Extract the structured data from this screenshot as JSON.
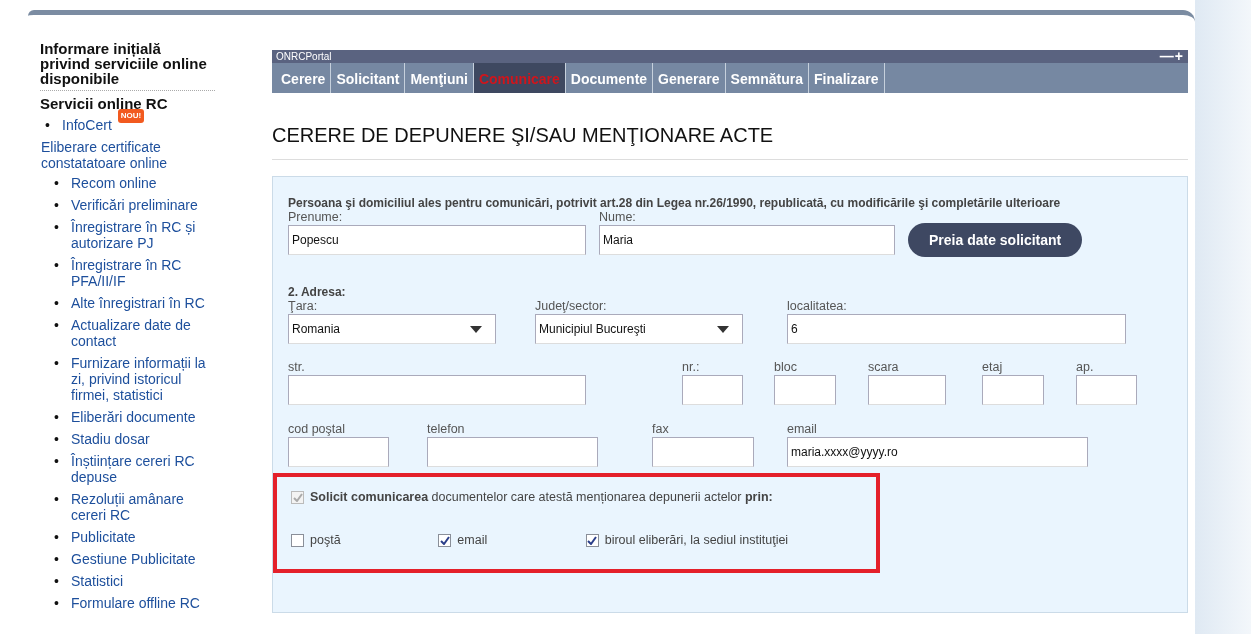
{
  "sidebar": {
    "intro_heading": "Informare inițială privind serviciile online disponibile",
    "section_heading": "Servicii online RC",
    "bullet": "•",
    "featured": {
      "label": "InfoCert",
      "badge": "NOU!"
    },
    "featured_description": "Eliberare certificate constatatoare online",
    "items": [
      "Recom online",
      "Verificări preliminare",
      "Înregistrare în RC și autorizare PJ",
      "Înregistrare în RC PFA/II/IF",
      "Alte înregistrari în RC",
      "Actualizare date de contact",
      "Furnizare informații la zi, privind istoricul firmei, statistici",
      "Eliberări documente",
      "Stadiu dosar",
      "Înștiințare cereri RC depuse",
      "Rezoluții amânare cereri RC",
      "Publicitate",
      "Gestiune Publicitate",
      "Statistici",
      "Formulare offline RC"
    ]
  },
  "portal": {
    "title": "ONRCPortal",
    "controls": "—+",
    "tabs": [
      {
        "label": "Cerere",
        "selected": false
      },
      {
        "label": "Solicitant",
        "selected": false
      },
      {
        "label": "Menţiuni",
        "selected": false
      },
      {
        "label": "Comunicare",
        "selected": true
      },
      {
        "label": "Documente",
        "selected": false
      },
      {
        "label": "Generare",
        "selected": false
      },
      {
        "label": "Semnătura",
        "selected": false
      },
      {
        "label": "Finalizare",
        "selected": false
      }
    ]
  },
  "page_title": "CERERE DE DEPUNERE ŞI/SAU MENŢIONARE ACTE",
  "form": {
    "intro": "Persoana şi domiciliul ales pentru comunicări, potrivit art.28 din Legea nr.26/1990, republicată, cu modificările şi completările ulterioare",
    "prenume": {
      "label": "Prenume:",
      "value": "Popescu"
    },
    "nume": {
      "label": "Nume:",
      "value": "Maria"
    },
    "fill_button": "Preia date solicitant",
    "address_heading": "2. Adresa:",
    "tara": {
      "label": "Ţara:",
      "value": "Romania"
    },
    "judet": {
      "label": "Judeţ/sector:",
      "value": "Municipiul Bucureşti"
    },
    "localitatea": {
      "label": "localitatea:",
      "value": "6"
    },
    "address_fields": [
      {
        "label": "str."
      },
      {
        "label": "nr.:"
      },
      {
        "label": "bloc"
      },
      {
        "label": "scara"
      },
      {
        "label": "etaj"
      },
      {
        "label": "ap."
      }
    ],
    "contact_fields": [
      {
        "label": "cod poştal"
      },
      {
        "label": "telefon"
      },
      {
        "label": "fax"
      },
      {
        "label": "email",
        "value": "maria.xxxx@yyyy.ro"
      }
    ],
    "communication": {
      "text": "**Solicit comunicarea** documentelor care atestă menționarea depunerii actelor **prin:**",
      "checked": true,
      "disabled": true,
      "options": [
        {
          "label": "poştă",
          "checked": false
        },
        {
          "label": "email",
          "checked": true
        },
        {
          "label": "biroul eliberări, la sediul instituţiei",
          "checked": true
        }
      ]
    }
  }
}
